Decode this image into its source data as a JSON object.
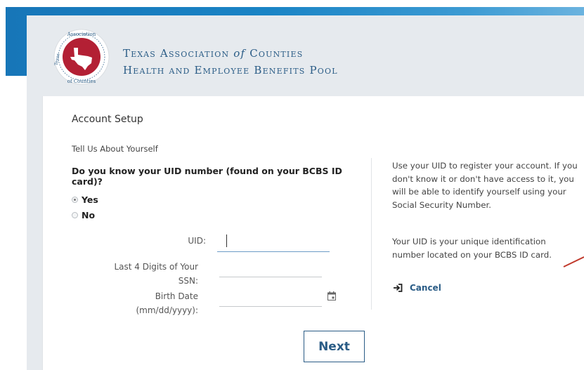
{
  "header": {
    "line1_a": "Texas Association ",
    "line1_b": "of",
    "line1_c": " Counties",
    "line2": "Health and Employee Benefits Pool",
    "seal_text_top": "Association",
    "seal_text_bottom": "of Counties",
    "seal_text_left": "Texas"
  },
  "form": {
    "section_title": "Account Setup",
    "subtitle": "Tell Us About Yourself",
    "question": "Do you know your UID number (found on your BCBS ID card)?",
    "options": [
      {
        "label": "Yes",
        "checked": true
      },
      {
        "label": "No",
        "checked": false
      }
    ],
    "uid_label": "UID:",
    "uid_value": "",
    "ssn_label_1": "Last 4 Digits of Your",
    "ssn_label_2": "SSN:",
    "ssn_value": "",
    "birth_label_1": "Birth Date",
    "birth_label_2": "(mm/dd/yyyy):",
    "birth_value": "",
    "next_label": "Next"
  },
  "help": {
    "paragraph1": "Use your UID to register your account. If you don't know it or don't have access to it, you will be able to identify yourself using your Social Security Number.",
    "paragraph2": "Your UID is your unique identification number located on your BCBS ID card.",
    "cancel_label": "Cancel"
  },
  "colors": {
    "banner_blue": "#1a84c5",
    "brand_navy": "#2a5c86",
    "seal_red": "#b32034",
    "page_grey": "#e6eaee",
    "pointer_red": "#c0392b"
  },
  "icons": {
    "calendar": "calendar-icon",
    "cancel": "sign-in-arrow-icon",
    "logo": "texas-seal-icon"
  }
}
